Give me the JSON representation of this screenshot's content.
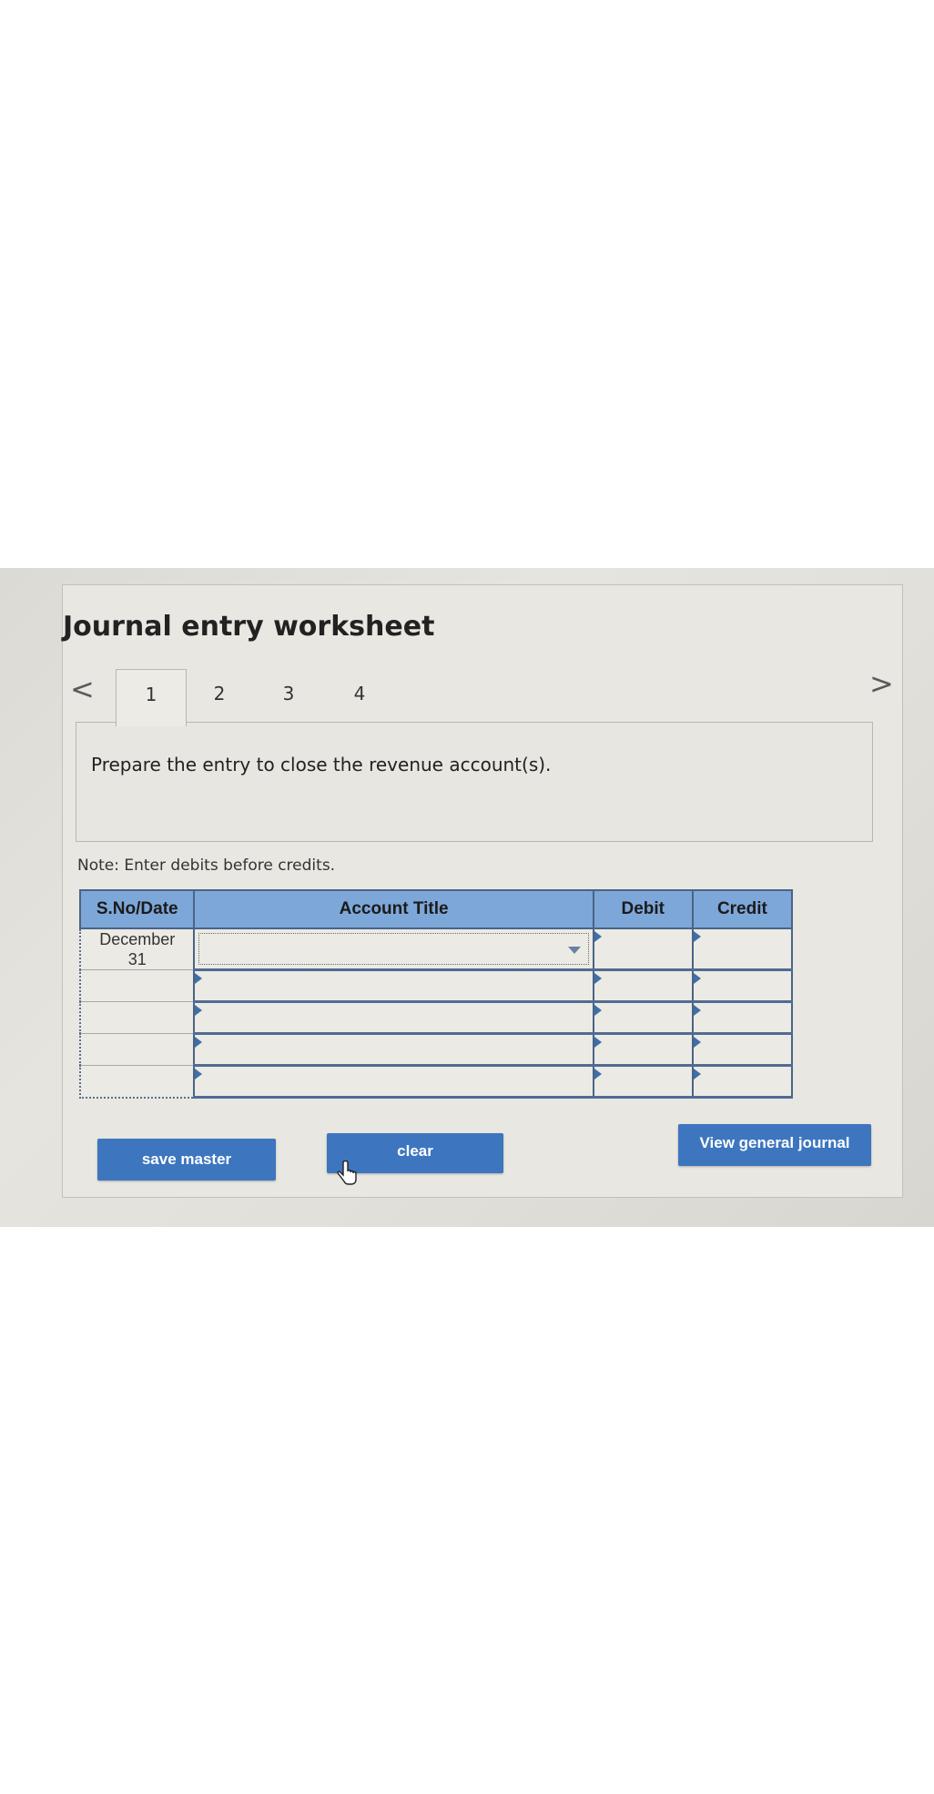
{
  "worksheet": {
    "title": "Journal entry worksheet"
  },
  "navigation": {
    "prev_glyph": "<",
    "next_glyph": ">",
    "tabs": [
      {
        "label": "1",
        "active": true
      },
      {
        "label": "2",
        "active": false
      },
      {
        "label": "3",
        "active": false
      },
      {
        "label": "4",
        "active": false
      }
    ]
  },
  "prompt": {
    "text": "Prepare the entry to close the revenue account(s)."
  },
  "note": "Note: Enter debits before credits.",
  "table": {
    "headers": {
      "date": "S.No/Date",
      "account": "Account Title",
      "debit": "Debit",
      "credit": "Credit"
    },
    "first_row_date_line1": "December",
    "first_row_date_line2": "31"
  },
  "buttons": {
    "save": "save master",
    "clear": "clear",
    "view_journal": "View general journal"
  },
  "icons": {
    "dropdown": "chevron-down-icon",
    "cursor": "hand-pointer-icon"
  },
  "colors": {
    "header_blue": "#7da7d8",
    "button_blue": "#3d76bf",
    "row_border": "#4f6c93"
  }
}
